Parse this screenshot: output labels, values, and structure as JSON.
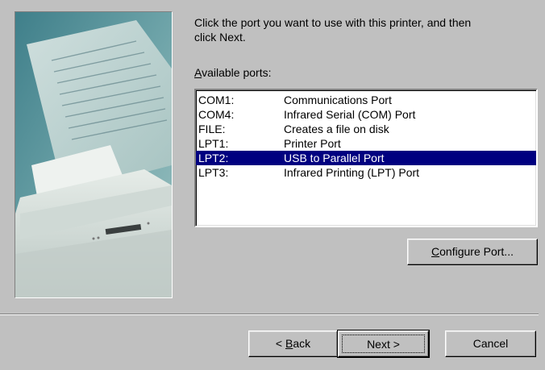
{
  "instruction": {
    "line1": "Click the port you want to use with this printer, and then",
    "line2": "click Next."
  },
  "ports_label": {
    "accel": "A",
    "rest": "vailable ports:"
  },
  "ports": [
    {
      "name": "COM1:",
      "description": "Communications Port",
      "selected": false
    },
    {
      "name": "COM4:",
      "description": "Infrared Serial (COM) Port",
      "selected": false
    },
    {
      "name": "FILE:",
      "description": "Creates a file on disk",
      "selected": false
    },
    {
      "name": "LPT1:",
      "description": "Printer Port",
      "selected": false
    },
    {
      "name": "LPT2:",
      "description": "USB to Parallel Port",
      "selected": true
    },
    {
      "name": "LPT3:",
      "description": "Infrared Printing (LPT) Port",
      "selected": false
    }
  ],
  "buttons": {
    "configure": {
      "accel": "C",
      "rest": "onfigure Port..."
    },
    "back": {
      "prefix": "< ",
      "accel": "B",
      "rest": "ack"
    },
    "next": {
      "label": "Next >"
    },
    "cancel": {
      "label": "Cancel"
    }
  },
  "colors": {
    "dialog_bg": "#c0c0c0",
    "selection_bg": "#000080",
    "selection_fg": "#ffffff"
  },
  "illustration": {
    "icon": "printer-illustration"
  }
}
